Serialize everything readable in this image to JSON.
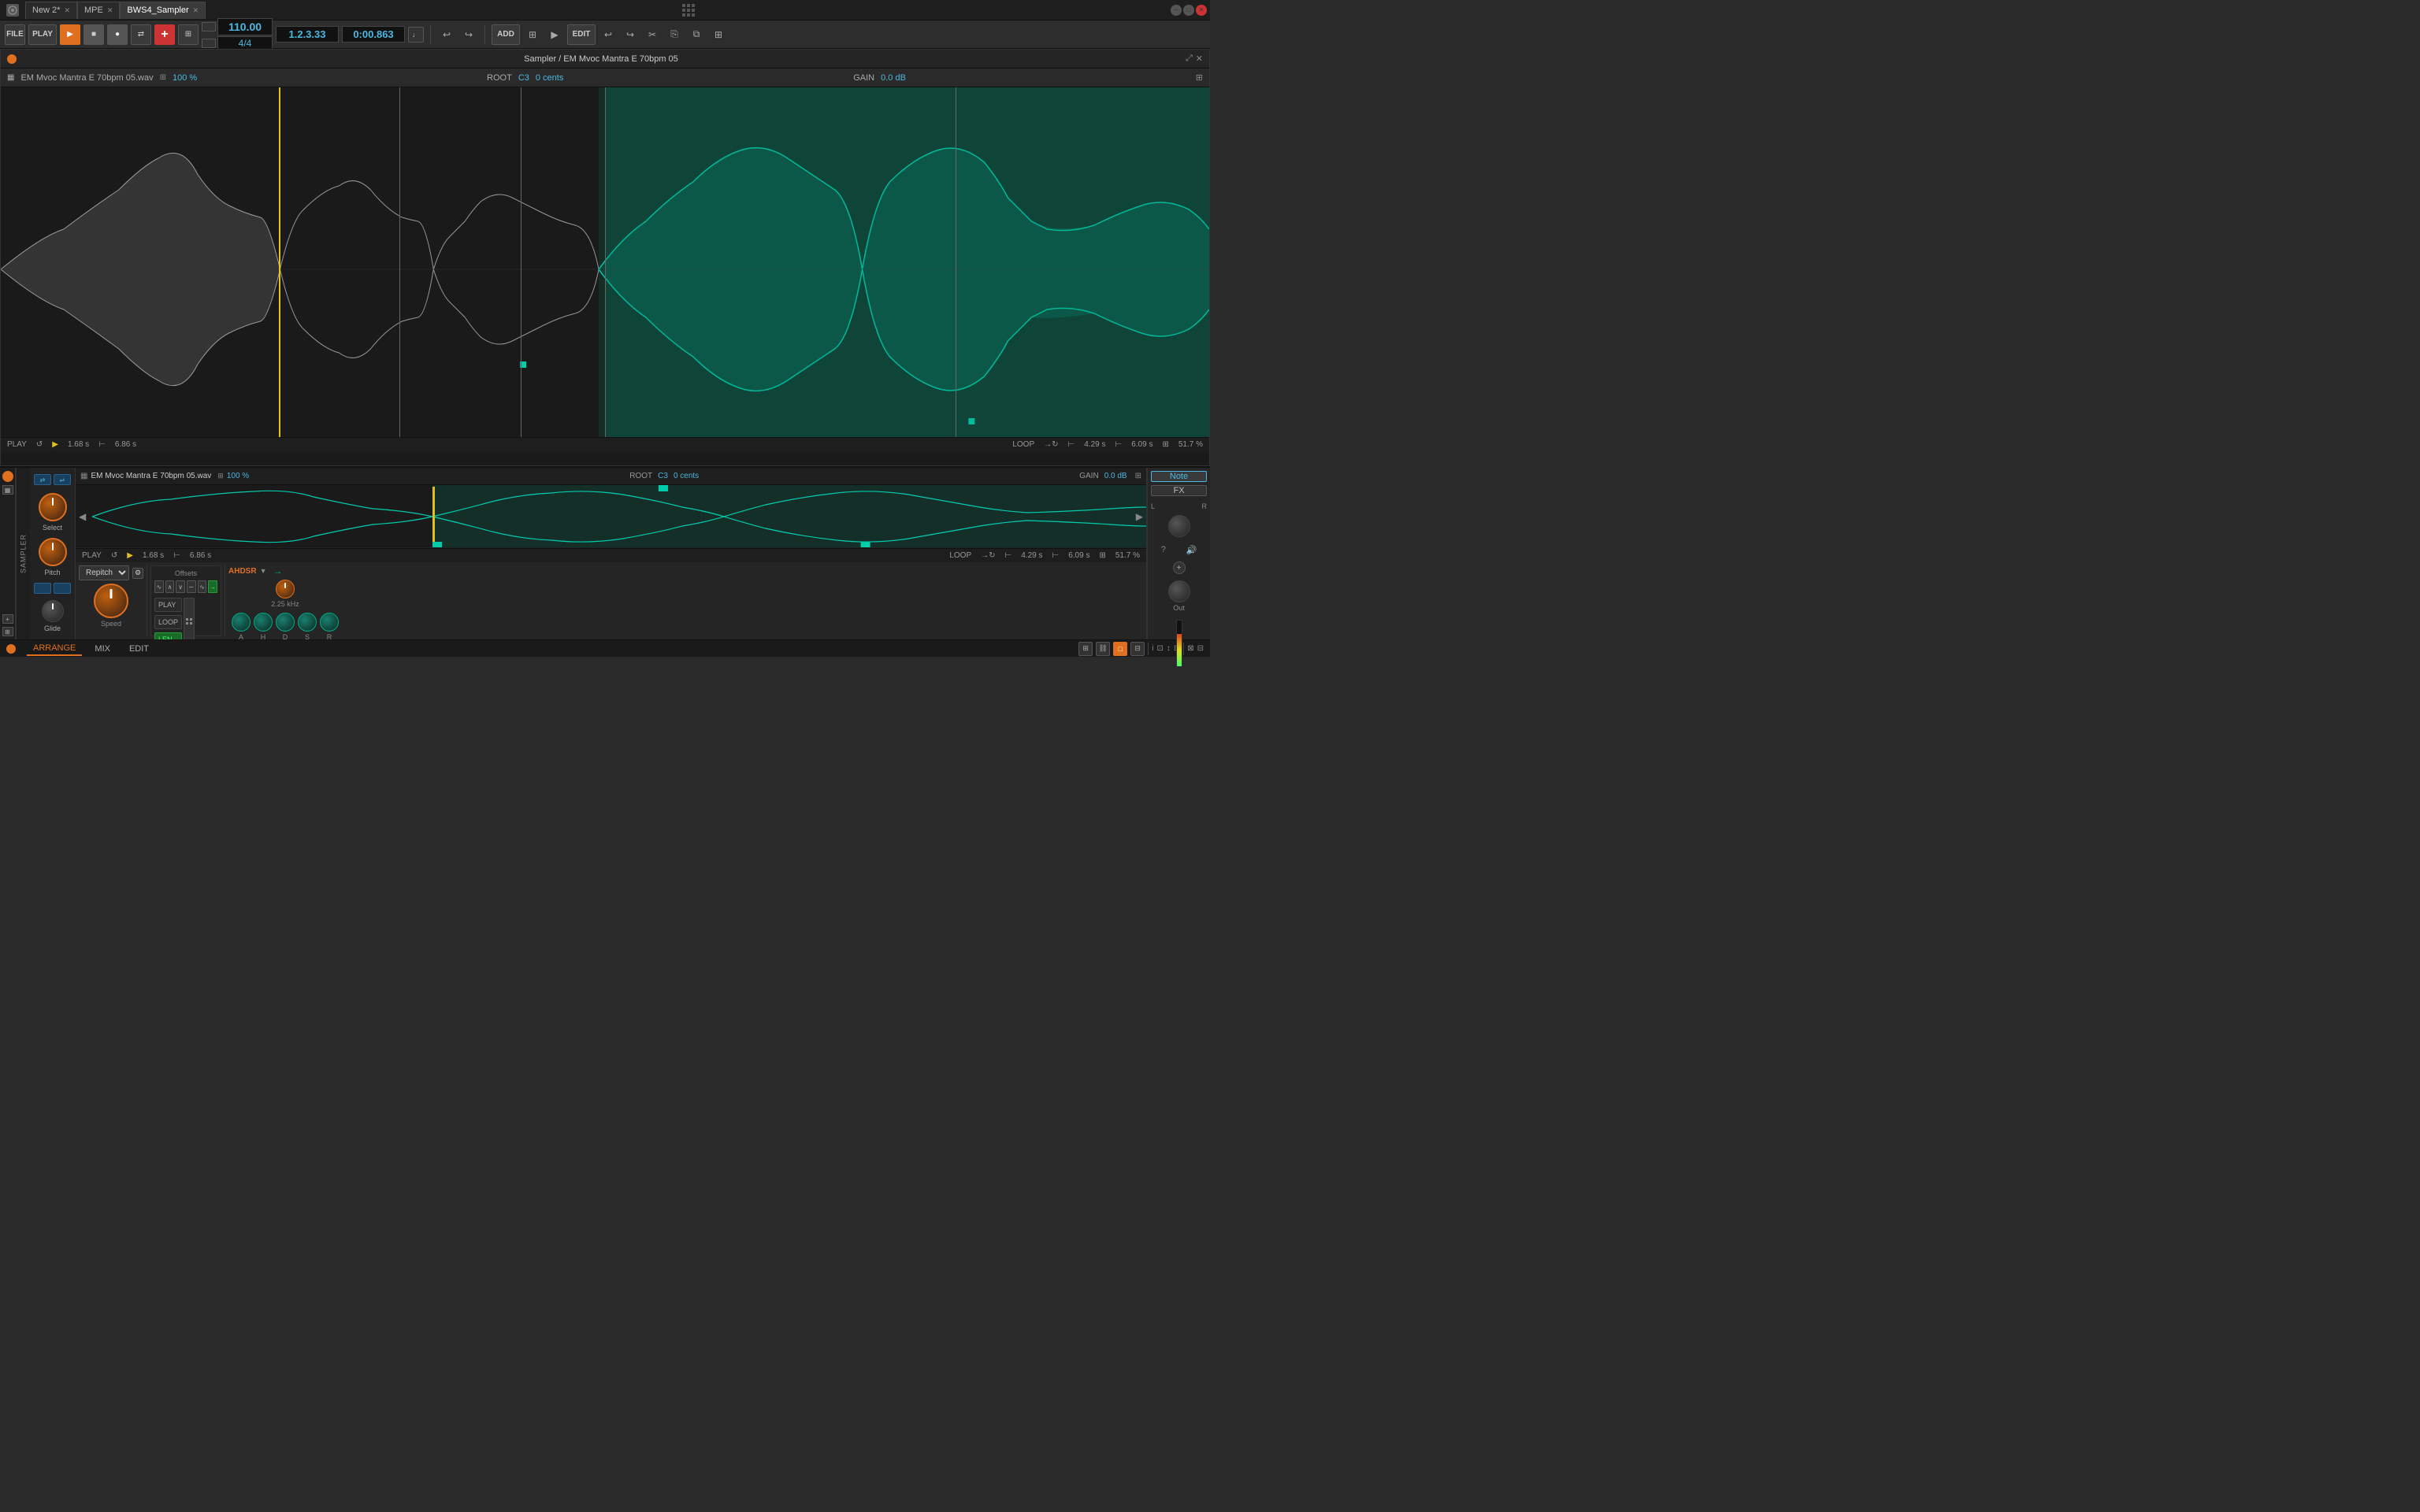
{
  "tabs": [
    {
      "label": "New 2*",
      "active": false,
      "closeable": true
    },
    {
      "label": "MPE",
      "active": false,
      "closeable": true
    },
    {
      "label": "BWS4_Sampler",
      "active": true,
      "closeable": true
    }
  ],
  "transport": {
    "file_label": "FILE",
    "play_label": "PLAY",
    "add_label": "ADD",
    "edit_label": "EDIT",
    "tempo": "110.00",
    "time_sig": "4/4",
    "position": "1.2.3.33",
    "time": "0:00.863"
  },
  "sampler_window": {
    "title": "Sampler / EM Mvoc Mantra E 70bpm 05",
    "file_name": "EM Mvoc Mantra E 70bpm 05.wav",
    "zoom": "100 %",
    "root": "C3",
    "cents": "0 cents",
    "gain": "0.0 dB",
    "play_time": "1.68 s",
    "total_time": "6.86 s",
    "loop_label": "LOOP",
    "loop_time1": "4.29 s",
    "loop_time2": "6.09 s",
    "loop_pct": "51.7 %"
  },
  "bottom_panel": {
    "sampler_label": "SAMPLER",
    "file_name": "EM Mvoc Mantra E 70bpm 05.wav",
    "zoom": "100 %",
    "root": "C3",
    "cents": "0 cents",
    "gain": "0.0 dB",
    "play_time": "1.68 s",
    "total_time": "6.86 s",
    "loop_label": "LOOP",
    "loop_time1": "4.29 s",
    "loop_time2": "6.09 s",
    "loop_pct": "51.7 %",
    "repitch": "Repitch",
    "note_btn": "Note",
    "fx_btn": "FX",
    "out_label": "Out",
    "speed_label": "Speed",
    "glide_label": "Glide",
    "ahdsr_label": "AHDSR",
    "offsets_label": "Offsets",
    "play_mode": "PLAY",
    "loop_mode": "LOOP",
    "len_mode": "LEN",
    "env_a": "A",
    "env_h": "H",
    "env_d": "D",
    "env_s": "S",
    "env_r": "R",
    "freq_label": "2.25 kHz",
    "select_label": "Select",
    "pitch_label": "Pitch"
  },
  "bottom_nav": {
    "arrange": "ARRANGE",
    "mix": "MIX",
    "edit": "EDIT"
  },
  "colors": {
    "accent_orange": "#e07020",
    "accent_teal": "#00aa88",
    "accent_blue": "#4ab8e0",
    "waveform_teal": "#00ccaa",
    "waveform_white": "#dddddd",
    "bg_dark": "#1a1a1a",
    "bg_mid": "#252525",
    "bg_light": "#2d2d2d"
  }
}
